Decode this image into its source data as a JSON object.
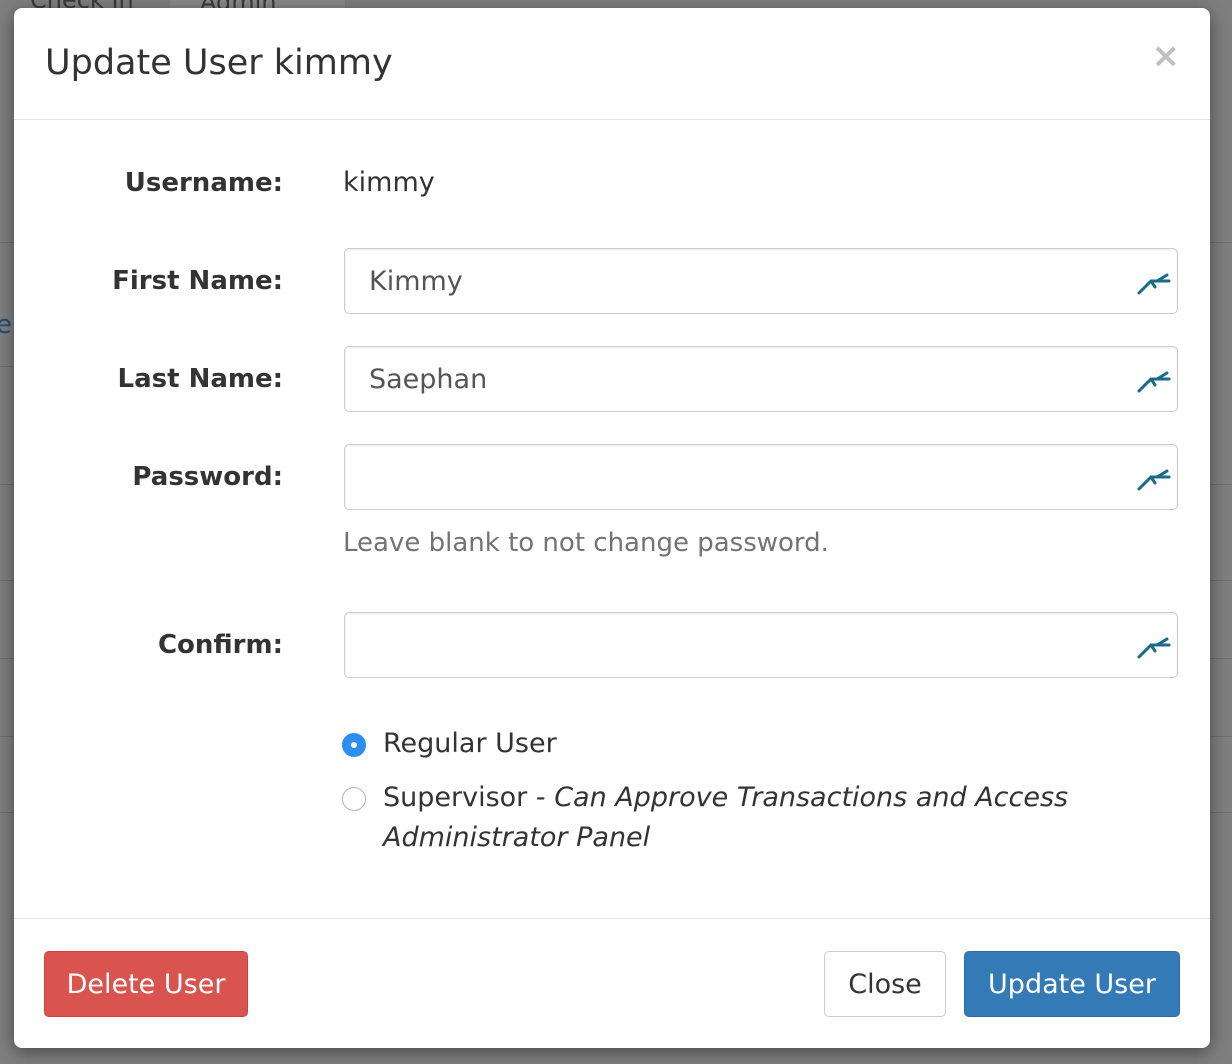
{
  "background": {
    "tabs": [
      "Check In",
      "Admin"
    ],
    "link_fragment": "e"
  },
  "modal": {
    "title": "Update User kimmy",
    "close_glyph": "×",
    "fields": {
      "username": {
        "label": "Username:",
        "value": "kimmy"
      },
      "first_name": {
        "label": "First Name:",
        "value": "Kimmy",
        "placeholder": ""
      },
      "last_name": {
        "label": "Last Name:",
        "value": "Saephan",
        "placeholder": ""
      },
      "password": {
        "label": "Password:",
        "value": "",
        "help": "Leave blank to not change password."
      },
      "confirm": {
        "label": "Confirm:",
        "value": ""
      }
    },
    "roles": {
      "selected": "regular",
      "regular": {
        "label": "Regular User"
      },
      "supervisor": {
        "label": "Supervisor",
        "separator": " - ",
        "description_line1": "Can Approve Transactions and Access",
        "description_line2": "Administrator Panel"
      }
    },
    "buttons": {
      "delete": "Delete User",
      "close": "Close",
      "update": "Update User"
    },
    "field_icon": "password-manager-key-icon"
  },
  "colors": {
    "danger": "#d9534f",
    "primary": "#337ab7",
    "radio_checked": "#2d8ef0",
    "key_icon": "#1a6b8a"
  }
}
